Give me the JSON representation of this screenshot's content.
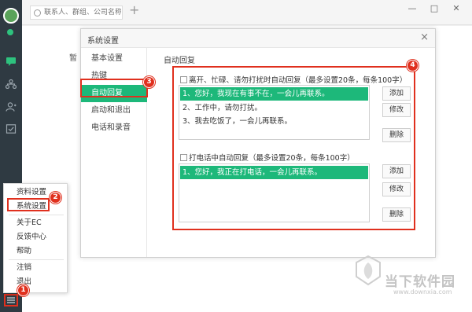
{
  "search": {
    "placeholder": "联系人、群组、公司名称"
  },
  "window": {
    "minimize": "—",
    "maximize": "□",
    "close": "✕"
  },
  "background": {
    "peek_text": "暂"
  },
  "dialog": {
    "title": "系统设置",
    "close": "×",
    "nav": [
      "基本设置",
      "热键",
      "自动回复",
      "启动和退出",
      "电话和录音"
    ],
    "active_nav": "自动回复",
    "section_title": "自动回复",
    "busy_reply": {
      "checkbox_label": "离开、忙碌、请勿打扰时自动回复（最多设置20条，每条100字）",
      "messages": [
        "1、您好，我现在有事不在，一会儿再联系。",
        "2、工作中，请勿打扰。",
        "3、我去吃饭了，一会儿再联系。"
      ],
      "selected_index": 0
    },
    "call_reply": {
      "checkbox_label": "打电话中自动回复（最多设置20条，每条100字）",
      "messages": [
        "1、您好，我正在打电话，一会儿再联系。"
      ],
      "selected_index": 0
    },
    "buttons": {
      "add": "添加",
      "edit": "修改",
      "delete": "删除"
    }
  },
  "popup_menu": {
    "items": [
      "资料设置",
      "系统设置",
      "关于EC",
      "反馈中心",
      "帮助",
      "注销",
      "退出"
    ],
    "highlighted": "系统设置"
  },
  "badges": [
    "1",
    "2",
    "3",
    "4"
  ],
  "watermark": {
    "title": "当下软件园",
    "url": "www.downxia.com"
  },
  "colors": {
    "accent": "#1db87a",
    "annotation": "#e0301e",
    "sidebar": "#2f3a42"
  }
}
